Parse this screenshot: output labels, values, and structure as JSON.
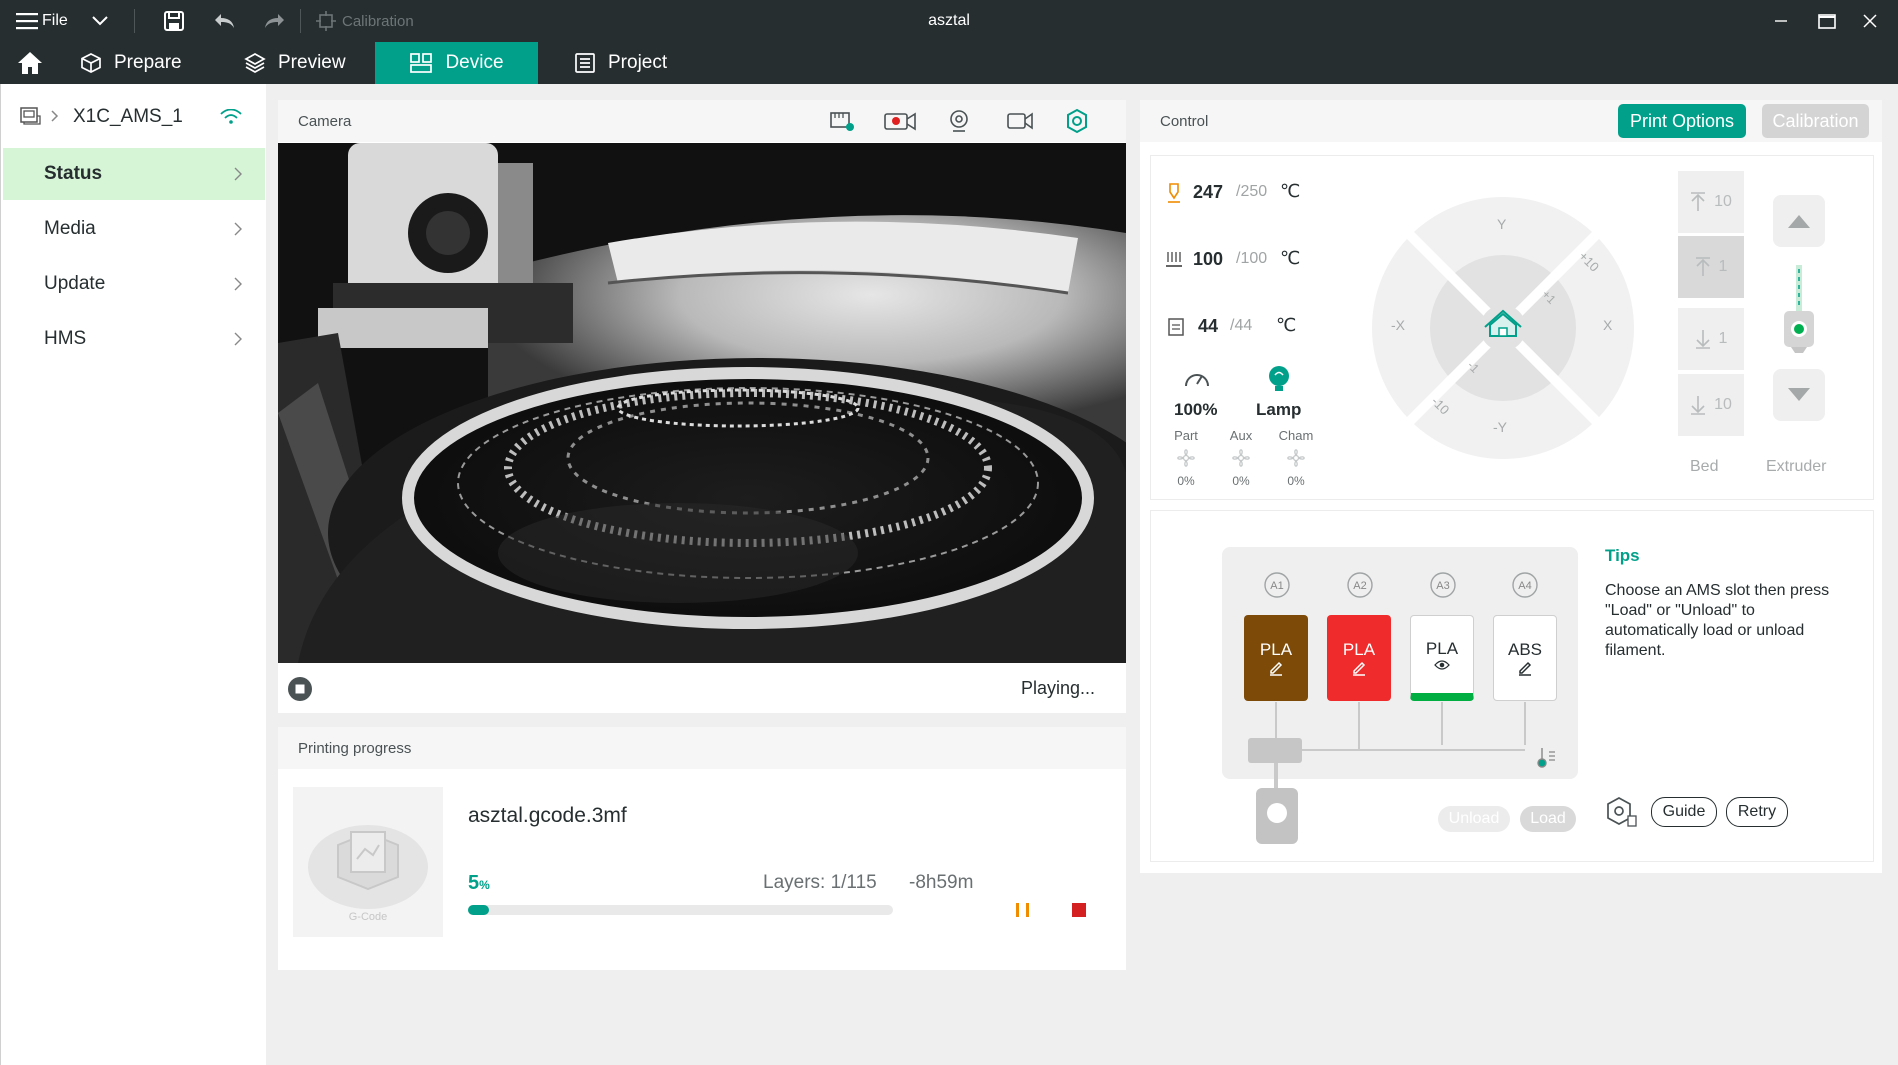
{
  "titlebar": {
    "menu_label": "File",
    "calibration_label": "Calibration",
    "window_title": "asztal"
  },
  "tabs": [
    {
      "label": "Prepare"
    },
    {
      "label": "Preview"
    },
    {
      "label": "Device",
      "active": true
    },
    {
      "label": "Project"
    }
  ],
  "sidebar": {
    "printer_name": "X1C_AMS_1",
    "items": [
      {
        "label": "Status",
        "active": true
      },
      {
        "label": "Media"
      },
      {
        "label": "Update"
      },
      {
        "label": "HMS"
      }
    ]
  },
  "camera": {
    "title": "Camera",
    "status": "Playing..."
  },
  "progress": {
    "title": "Printing progress",
    "thumbnail_label": "G-Code",
    "filename": "asztal.gcode.3mf",
    "percent_value": "5",
    "percent_unit": "%",
    "percent_fraction": 0.05,
    "layers": "Layers: 1/115",
    "remaining": "-8h59m"
  },
  "control": {
    "title": "Control",
    "print_options_label": "Print Options",
    "calibration_label": "Calibration",
    "temps": [
      {
        "current": "247",
        "target": "250",
        "unit": "℃"
      },
      {
        "current": "100",
        "target": "100",
        "unit": "℃"
      },
      {
        "current": "44",
        "target": "44",
        "unit": "℃"
      }
    ],
    "speed_value": "100%",
    "lamp_label": "Lamp",
    "fans": [
      {
        "label": "Part",
        "value": "0%"
      },
      {
        "label": "Aux",
        "value": "0%"
      },
      {
        "label": "Cham",
        "value": "0%"
      }
    ],
    "jog": {
      "y": "Y",
      "neg_y": "-Y",
      "x": "X",
      "neg_x": "-X",
      "plus10": "+10",
      "plus1": "+1",
      "minus1": "-1",
      "minus10": "-10"
    },
    "bed_steps": [
      "10",
      "1",
      "1",
      "10"
    ],
    "bed_label": "Bed",
    "extruder_label": "Extruder"
  },
  "ams": {
    "slots": [
      {
        "id": "A1",
        "material": "PLA",
        "color": "#7d4a08",
        "text_color": "#ffffff"
      },
      {
        "id": "A2",
        "material": "PLA",
        "color": "#ef2b2b",
        "text_color": "#ffffff"
      },
      {
        "id": "A3",
        "material": "PLA",
        "color": "#ffffff",
        "text_color": "#262e30"
      },
      {
        "id": "A4",
        "material": "ABS",
        "color": "#ffffff",
        "text_color": "#262e30"
      }
    ],
    "unload_label": "Unload",
    "load_label": "Load",
    "tips_title": "Tips",
    "tips_text": "Choose an AMS slot then press \"Load\" or \"Unload\" to automatically load or unload filament.",
    "guide_label": "Guide",
    "retry_label": "Retry"
  },
  "colors": {
    "accent": "#00a08a",
    "titlebar": "#262e30",
    "sidebar_active": "#d6f5d6",
    "stop": "#e02020",
    "pause": "#f08c00"
  }
}
